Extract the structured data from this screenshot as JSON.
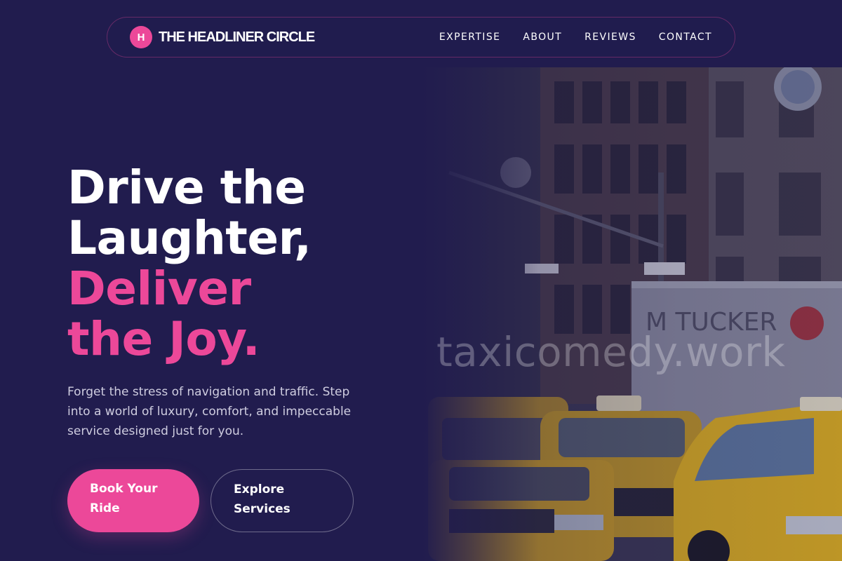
{
  "brand": {
    "badge_letter": "H",
    "name": "THE HEADLINER CIRCLE"
  },
  "nav": {
    "links": [
      "EXPERTISE",
      "ABOUT",
      "REVIEWS",
      "CONTACT"
    ]
  },
  "hero": {
    "headline_lines": [
      "Drive the",
      "Laughter,"
    ],
    "highlight_lines": [
      "Deliver",
      "the Joy."
    ],
    "subtext": "Forget the stress of navigation and traffic. Step into a world of luxury, comfort, and impeccable service designed just for you.",
    "primary_button": "Book Your Ride",
    "secondary_button": "Explore Services",
    "image_watermark": "taxicomedy.work"
  },
  "colors": {
    "background": "#211c4e",
    "accent_pink": "#ec4899",
    "text_white": "#ffffff",
    "text_muted": "#cfcde0",
    "taxi_yellow": "#e8b21c"
  },
  "icons": {
    "brand_badge": "letter-h-badge"
  }
}
